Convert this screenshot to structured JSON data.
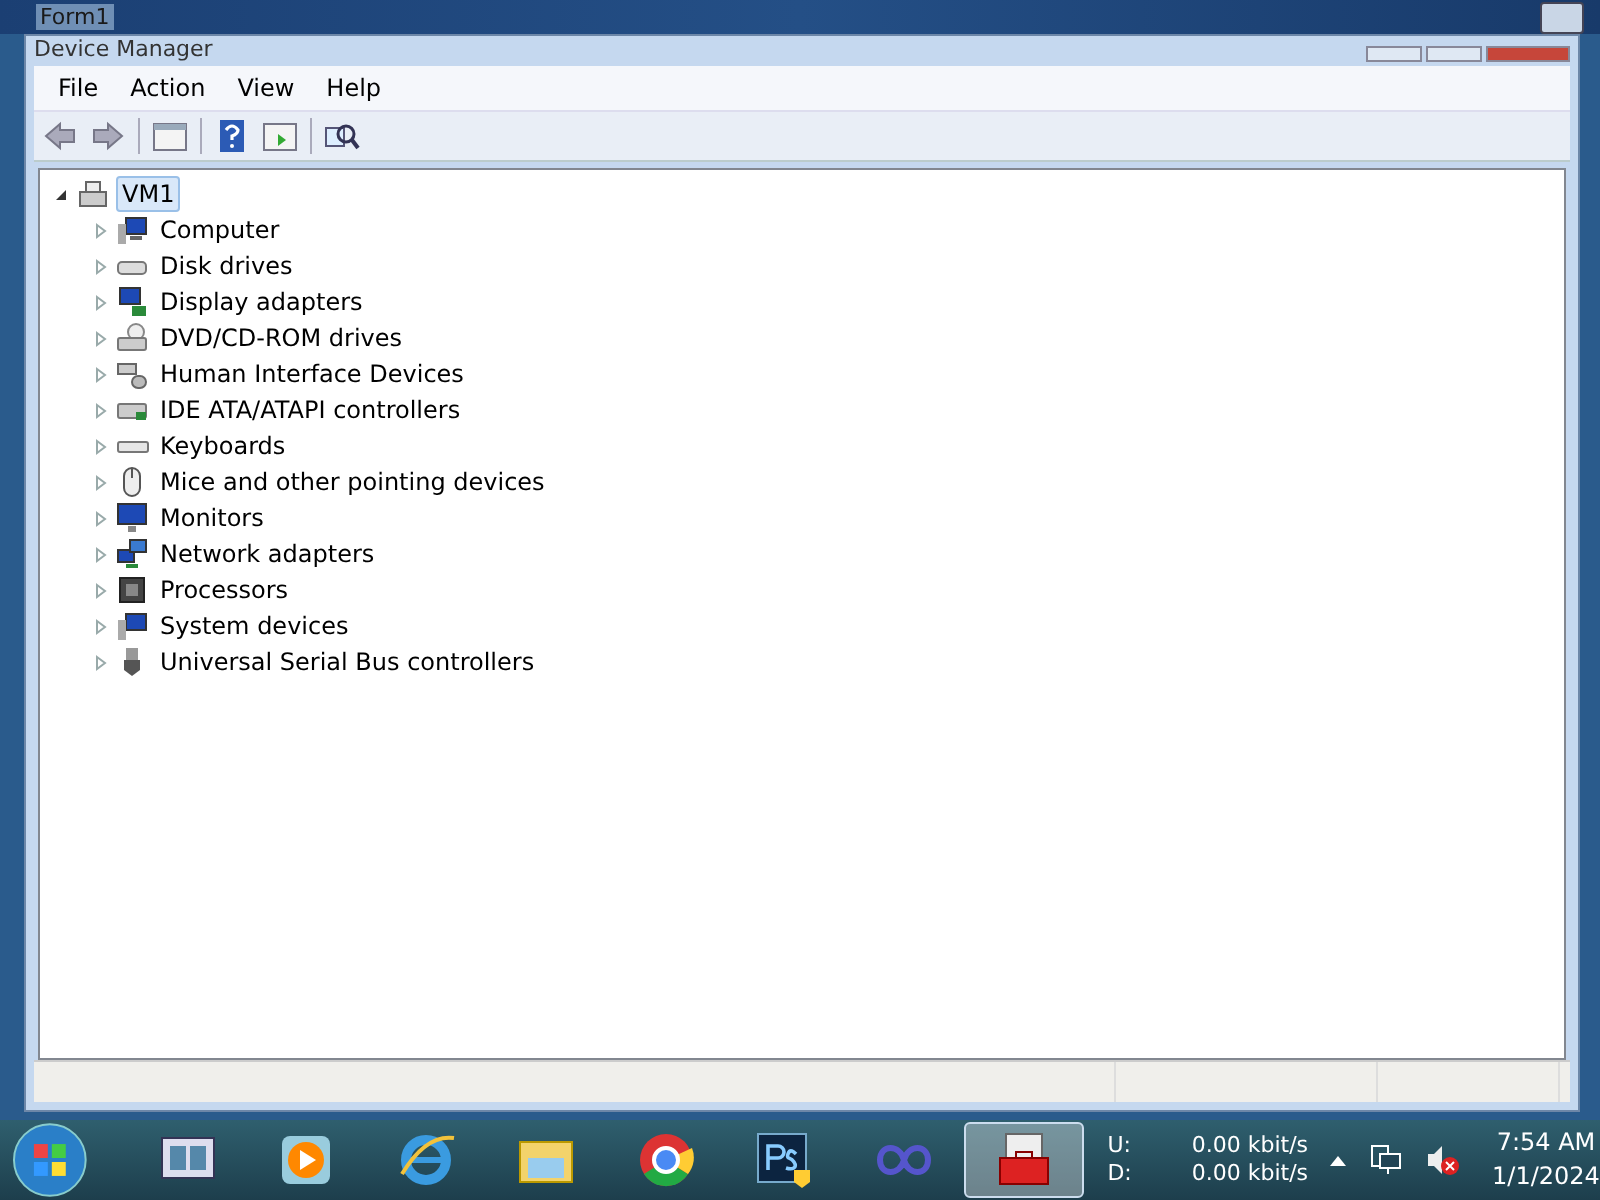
{
  "outer_window": {
    "title": "Form1"
  },
  "window": {
    "title": "Device Manager"
  },
  "menu": [
    "File",
    "Action",
    "View",
    "Help"
  ],
  "tree": {
    "root": {
      "label": "VM1",
      "expanded": true,
      "selected": true,
      "children": [
        {
          "label": "Computer",
          "expanded": false
        },
        {
          "label": "Disk drives",
          "expanded": false
        },
        {
          "label": "Display adapters",
          "expanded": false
        },
        {
          "label": "DVD/CD-ROM drives",
          "expanded": false
        },
        {
          "label": "Human Interface Devices",
          "expanded": false
        },
        {
          "label": "IDE ATA/ATAPI controllers",
          "expanded": false
        },
        {
          "label": "Keyboards",
          "expanded": false
        },
        {
          "label": "Mice and other pointing devices",
          "expanded": false
        },
        {
          "label": "Monitors",
          "expanded": false
        },
        {
          "label": "Network adapters",
          "expanded": false
        },
        {
          "label": "Processors",
          "expanded": false
        },
        {
          "label": "System devices",
          "expanded": false
        },
        {
          "label": "Universal Serial Bus controllers",
          "expanded": false
        }
      ]
    }
  },
  "taskbar": {
    "apps": [
      {
        "selected": false
      },
      {
        "selected": false
      },
      {
        "selected": false
      },
      {
        "selected": false
      },
      {
        "selected": false
      },
      {
        "selected": false
      },
      {
        "selected": false
      },
      {
        "selected": true
      }
    ],
    "net": [
      {
        "label": "U:",
        "rate": "0.00 kbit/s"
      },
      {
        "label": "D:",
        "rate": "0.00 kbit/s"
      }
    ],
    "time": "7:54 AM",
    "date": "1/1/2024"
  }
}
